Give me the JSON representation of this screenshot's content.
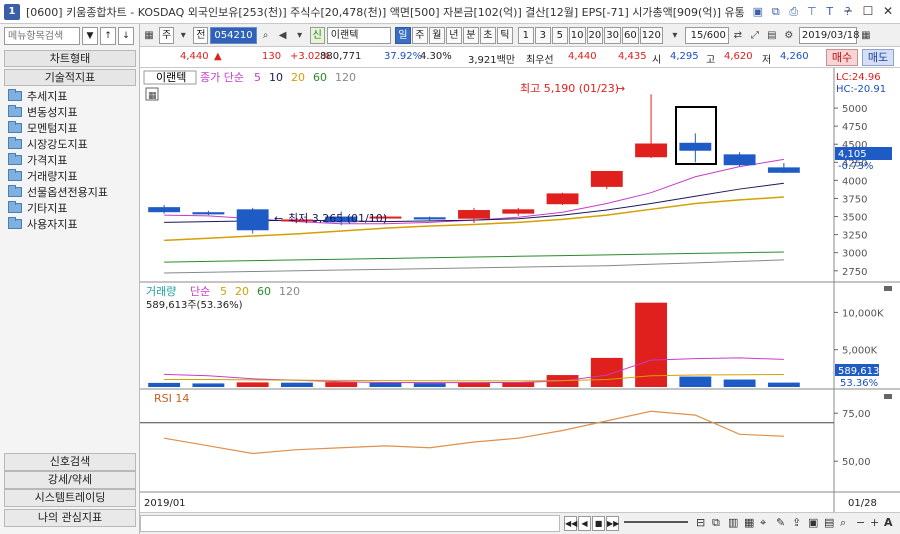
{
  "window": {
    "icon_label": "1",
    "title": "[0600] 키움종합차트 - KOSDAQ 외국인보유[253(천)] 주식수[20,478(천)] 액면[500] 자본금[102(억)] 결산[12월] EPS[-71] 시가총액[909(억)] 유통"
  },
  "left_panel": {
    "search_placeholder": "메뉴항목검색",
    "chart_type_header": "차트형태",
    "tech_header": "기술적지표",
    "items": [
      "추세지표",
      "변동성지표",
      "모멘텀지표",
      "시장강도지표",
      "가격지표",
      "거래량지표",
      "선물옵션전용지표",
      "기타지표",
      "사용자지표"
    ],
    "bottom": [
      "신호검색",
      "강세/약세",
      "시스템트레이딩",
      "나의 관심지표"
    ]
  },
  "toolbar": {
    "type_select": "주",
    "all_label": "전",
    "code": "054210",
    "badge": "신",
    "name": "이랜텍",
    "periods": [
      "일",
      "주",
      "월",
      "년",
      "분",
      "초",
      "틱"
    ],
    "selected_period": "일",
    "intervals": [
      "1",
      "3",
      "5",
      "10",
      "20",
      "30",
      "60",
      "120"
    ],
    "page_counter": "15/600",
    "date": "2019/03/18"
  },
  "quote": {
    "price": "4,440",
    "change_arrow": "▲",
    "change": "130",
    "change_pct": "+3.02%",
    "volume": "880,771",
    "ratio": "37.92%",
    "pct2": "4.30%",
    "amount": "3,921백만",
    "best_label": "최우선",
    "ask": "4,440",
    "bid": "4,435",
    "open_label": "시",
    "open": "4,295",
    "high_label": "고",
    "high": "4,620",
    "low_label": "저",
    "low": "4,260",
    "buy_label": "매수",
    "sell_label": "매도"
  },
  "chart": {
    "price_legend_name": "이랜텍",
    "price_legend_ma": "종가 단순",
    "lc_label": "LC:24.96",
    "hc_label": "HC:-20.91",
    "high_annotation": "최고 5,190 (01/23)",
    "low_annotation": "최저 3,265 (01/10)",
    "current_price": "4,105",
    "current_pct": "-0.73%",
    "volume_legend_name": "거래량",
    "volume_legend_ma": "단순",
    "volume_value_text": "589,613주(53.36%)",
    "volume_current": "589,613",
    "volume_current_pct": "53.36%",
    "rsi_legend": "RSI 14",
    "x_start": "2019/01",
    "x_end": "01/28"
  },
  "chart_data": [
    {
      "type": "candlestick",
      "ylim": [
        2650,
        5250
      ],
      "yticks": [
        5000,
        4750,
        4500,
        4250,
        4000,
        3750,
        3500,
        3250,
        3000,
        2750
      ],
      "ma_periods": [
        {
          "label": "5",
          "color": "#c83cc8"
        },
        {
          "label": "10",
          "color": "#1a1a5a"
        },
        {
          "label": "20",
          "color": "#d4a000"
        },
        {
          "label": "60",
          "color": "#2a8a2a"
        },
        {
          "label": "120",
          "color": "#888888"
        }
      ],
      "candles": [
        {
          "o": 3630,
          "h": 3660,
          "l": 3540,
          "c": 3560
        },
        {
          "o": 3560,
          "h": 3580,
          "l": 3520,
          "c": 3530
        },
        {
          "o": 3600,
          "h": 3620,
          "l": 3265,
          "c": 3310
        },
        {
          "o": 3450,
          "h": 3480,
          "l": 3430,
          "c": 3460
        },
        {
          "o": 3500,
          "h": 3570,
          "l": 3380,
          "c": 3420
        },
        {
          "o": 3480,
          "h": 3520,
          "l": 3450,
          "c": 3500
        },
        {
          "o": 3490,
          "h": 3500,
          "l": 3440,
          "c": 3460
        },
        {
          "o": 3470,
          "h": 3620,
          "l": 3410,
          "c": 3590
        },
        {
          "o": 3540,
          "h": 3620,
          "l": 3510,
          "c": 3600
        },
        {
          "o": 3670,
          "h": 3830,
          "l": 3660,
          "c": 3820
        },
        {
          "o": 3910,
          "h": 4130,
          "l": 3880,
          "c": 4130
        },
        {
          "o": 4320,
          "h": 5190,
          "l": 4310,
          "c": 4510
        },
        {
          "o": 4520,
          "h": 4650,
          "l": 4250,
          "c": 4410
        },
        {
          "o": 4360,
          "h": 4390,
          "l": 4190,
          "c": 4210
        },
        {
          "o": 4180,
          "h": 4240,
          "l": 4100,
          "c": 4105
        }
      ],
      "ma5": [
        3520,
        3510,
        3470,
        3430,
        3400,
        3400,
        3420,
        3450,
        3490,
        3560,
        3680,
        3830,
        4050,
        4190,
        4290
      ],
      "ma10": [
        3420,
        3430,
        3440,
        3450,
        3440,
        3430,
        3440,
        3450,
        3470,
        3520,
        3590,
        3680,
        3780,
        3880,
        3960
      ],
      "ma20": [
        3170,
        3200,
        3230,
        3260,
        3300,
        3340,
        3370,
        3390,
        3420,
        3460,
        3520,
        3600,
        3680,
        3730,
        3770
      ],
      "ma60": [
        2870,
        2880,
        2890,
        2900,
        2910,
        2920,
        2930,
        2940,
        2950,
        2960,
        2970,
        2980,
        2990,
        3000,
        3010
      ],
      "ma120": [
        2720,
        2730,
        2740,
        2750,
        2760,
        2770,
        2780,
        2790,
        2800,
        2810,
        2820,
        2840,
        2860,
        2880,
        2900
      ]
    },
    {
      "type": "bar",
      "title": "거래량",
      "ylim": [
        0,
        13000
      ],
      "yticks": [
        10000,
        5000
      ],
      "ytick_labels": [
        "10,000K",
        "5,000K"
      ],
      "ma_periods": [
        {
          "label": "5",
          "color": "#d4a000"
        },
        {
          "label": "20",
          "color": "#d4a000"
        },
        {
          "label": "60",
          "color": "#2a8a2a"
        },
        {
          "label": "120",
          "color": "#888888"
        }
      ],
      "values": [
        550,
        480,
        620,
        580,
        650,
        560,
        520,
        560,
        650,
        1600,
        3900,
        11300,
        1400,
        1000,
        589.613
      ],
      "up": [
        false,
        false,
        true,
        false,
        true,
        false,
        false,
        true,
        true,
        true,
        true,
        true,
        false,
        false,
        false
      ],
      "ma5": [
        1700,
        1500,
        1100,
        900,
        700,
        600,
        580,
        580,
        600,
        800,
        1600,
        3600,
        3800,
        3900,
        3700
      ],
      "ma20": [
        1000,
        1000,
        950,
        900,
        880,
        850,
        830,
        820,
        820,
        850,
        1000,
        1500,
        1600,
        1650,
        1680
      ]
    },
    {
      "type": "line",
      "title": "RSI 14",
      "ylim": [
        35,
        85
      ],
      "yticks": [
        75,
        50
      ],
      "ytick_labels": [
        "75,00",
        "50,00"
      ],
      "guides": [
        70
      ],
      "values": [
        62,
        58,
        54,
        56,
        57,
        58,
        57,
        60,
        62,
        66,
        71,
        76,
        74,
        64,
        63
      ]
    }
  ],
  "colors": {
    "up": "#e0201c",
    "down": "#1f5bc4",
    "rsi_line": "#e0904a",
    "selection_box": "#000000",
    "current_price_bg": "#1f5bc4"
  }
}
